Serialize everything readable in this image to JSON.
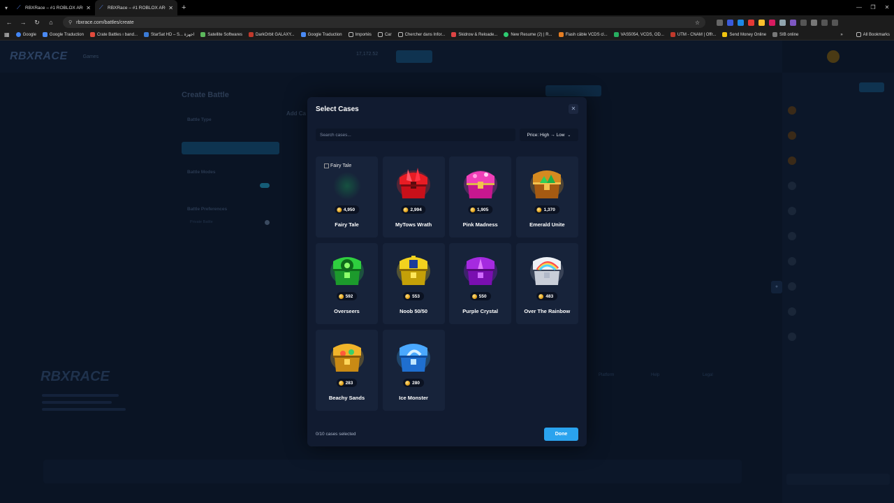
{
  "browser": {
    "tabs": [
      {
        "title": "RBXRace – #1 ROBLOX ARCADE",
        "active": false
      },
      {
        "title": "RBXRace – #1 ROBLOX ARCADE",
        "active": true
      }
    ],
    "url": "rbxrace.com/battles/create",
    "bookmarks": [
      {
        "label": "Google",
        "color": "#4285f4"
      },
      {
        "label": "Google Traduction",
        "color": "#4a8af4"
      },
      {
        "label": "Crate Battles ı band...",
        "color": "#e34b3c"
      },
      {
        "label": "StarSat HD – S... اجهزة",
        "color": "#3b7bd5"
      },
      {
        "label": "Satellite Softwares",
        "color": "#5cb85c"
      },
      {
        "label": "DarkOrbit GALAXY...",
        "color": "#c0392b"
      },
      {
        "label": "Google Traduction",
        "color": "#4a8af4"
      },
      {
        "label": "Importés",
        "color": "#888888"
      },
      {
        "label": "Car",
        "color": "#888888"
      },
      {
        "label": "Chercher dans Infor...",
        "color": "#888888"
      },
      {
        "label": "Skidrow & Reloade...",
        "color": "#d44"
      },
      {
        "label": "New Resume (2) | R...",
        "color": "#2ecc71"
      },
      {
        "label": "Flash câble VCDS cl...",
        "color": "#e67e22"
      },
      {
        "label": "VAS5054, VCDS, OD...",
        "color": "#27ae60"
      },
      {
        "label": "UTM - CNAM | Offr...",
        "color": "#c0392b"
      },
      {
        "label": "Send Money Online",
        "color": "#f1c40f"
      },
      {
        "label": "SIB online",
        "color": "#777777"
      }
    ],
    "all_bookmarks": "All Bookmarks"
  },
  "site": {
    "logo": "RBXRACE",
    "nav_games": "Games",
    "balance": "17,172.52",
    "page_title": "Create Battle",
    "sections": [
      "Battle Type",
      "Battle Modes",
      "Battle Preferences"
    ],
    "private_battle": "Private Battle",
    "add_cases": "Add Ca",
    "footer_cols": [
      "Platform",
      "Help",
      "Legal"
    ]
  },
  "modal": {
    "title": "Select Cases",
    "search_placeholder": "Search cases...",
    "sort_label": "Price: High → Low",
    "cases": [
      {
        "name": "Fairy Tale",
        "price": "4,950",
        "broken_image_alt": "Fairy Tale"
      },
      {
        "name": "MyTows Wrath",
        "price": "2,994"
      },
      {
        "name": "Pink Madness",
        "price": "1,905"
      },
      {
        "name": "Emerald Unite",
        "price": "1,370"
      },
      {
        "name": "Overseers",
        "price": "592"
      },
      {
        "name": "Noob 50/50",
        "price": "553"
      },
      {
        "name": "Purple Crystal",
        "price": "550"
      },
      {
        "name": "Over The Rainbow",
        "price": "483"
      },
      {
        "name": "Beachy Sands",
        "price": "283"
      },
      {
        "name": "Ice Monster",
        "price": "280"
      }
    ],
    "selected_count": "0/10 cases selected",
    "done_label": "Done"
  },
  "colors": {
    "accent": "#2aa3ee",
    "modal_bg": "#111b30",
    "card_bg": "#17233a",
    "coin": "#e0a11a"
  }
}
